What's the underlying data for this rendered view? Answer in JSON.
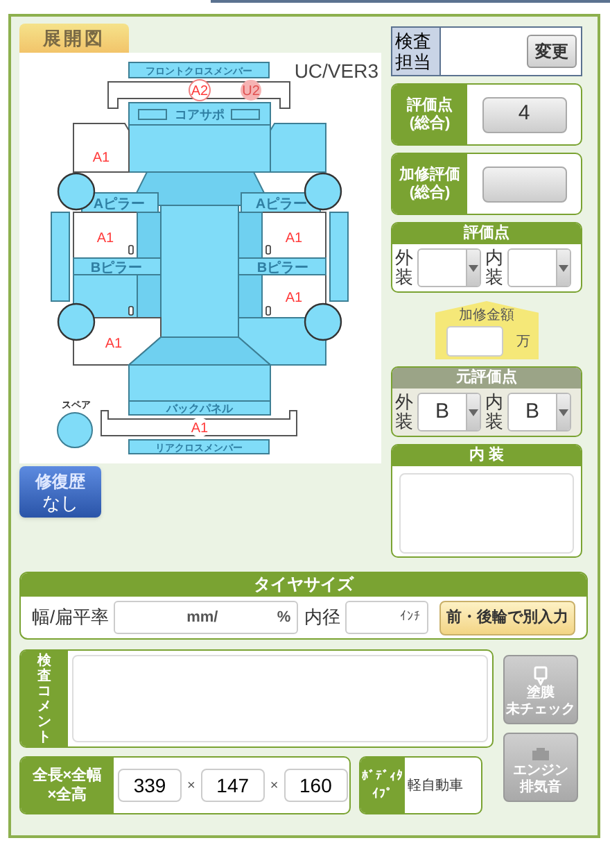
{
  "diagram": {
    "title": "展開図",
    "version": "UC/VER3",
    "panels": [
      "フロントクロスメンバー",
      "コアサポ",
      "Aピラー",
      "Aピラー",
      "Bピラー",
      "Bピラー",
      "バックパネル",
      "リアクロスメンバー",
      "スペア"
    ],
    "marks": [
      {
        "code": "A2",
        "kind": "ring"
      },
      {
        "code": "U2",
        "kind": "filled"
      },
      {
        "code": "A1",
        "kind": "plain"
      },
      {
        "code": "A1",
        "kind": "plain"
      },
      {
        "code": "A1",
        "kind": "plain"
      },
      {
        "code": "A1",
        "kind": "plain"
      },
      {
        "code": "A1",
        "kind": "plain"
      },
      {
        "code": "A1",
        "kind": "backed"
      }
    ]
  },
  "repair_history": {
    "label": "修復歴",
    "value": "なし"
  },
  "inspector": {
    "label": "検査担当",
    "button": "変更"
  },
  "overall_score": {
    "label": [
      "評価点",
      "(総合)"
    ],
    "value": "4"
  },
  "repair_score": {
    "label": [
      "加修評価",
      "(総合)"
    ]
  },
  "score": {
    "title": "評価点",
    "selects": [
      {
        "label": "外装"
      },
      {
        "label": "内装"
      }
    ]
  },
  "repair_cost": {
    "label": "加修金額",
    "unit": "万"
  },
  "original_score": {
    "title": "元評価点",
    "selects": [
      {
        "label": "外装",
        "value": "B"
      },
      {
        "label": "内装",
        "value": "B"
      }
    ]
  },
  "interior": {
    "title": "内 装"
  },
  "tire_size": {
    "title": "タイヤサイズ",
    "width_label": "幅/扁平率",
    "width_unit": "mm/",
    "ratio_unit": "%",
    "diameter_label": "内径",
    "diameter_unit": "ｲﾝﾁ",
    "button": "前・後輪で別入力"
  },
  "comment": {
    "label": "検査コメント"
  },
  "side_buttons": [
    {
      "kind": "paint",
      "label": [
        "塗膜",
        "未チェック"
      ]
    },
    {
      "kind": "engine",
      "label": [
        "エンジン",
        "排気音"
      ]
    }
  ],
  "dimensions": {
    "label": [
      "全長×全幅",
      "×全高"
    ],
    "values": [
      "339",
      "147",
      "160"
    ],
    "separator": "×"
  },
  "body_type": {
    "label": "ﾎﾞﾃﾞｨﾀｲﾌﾟ",
    "value": "軽自動車"
  }
}
